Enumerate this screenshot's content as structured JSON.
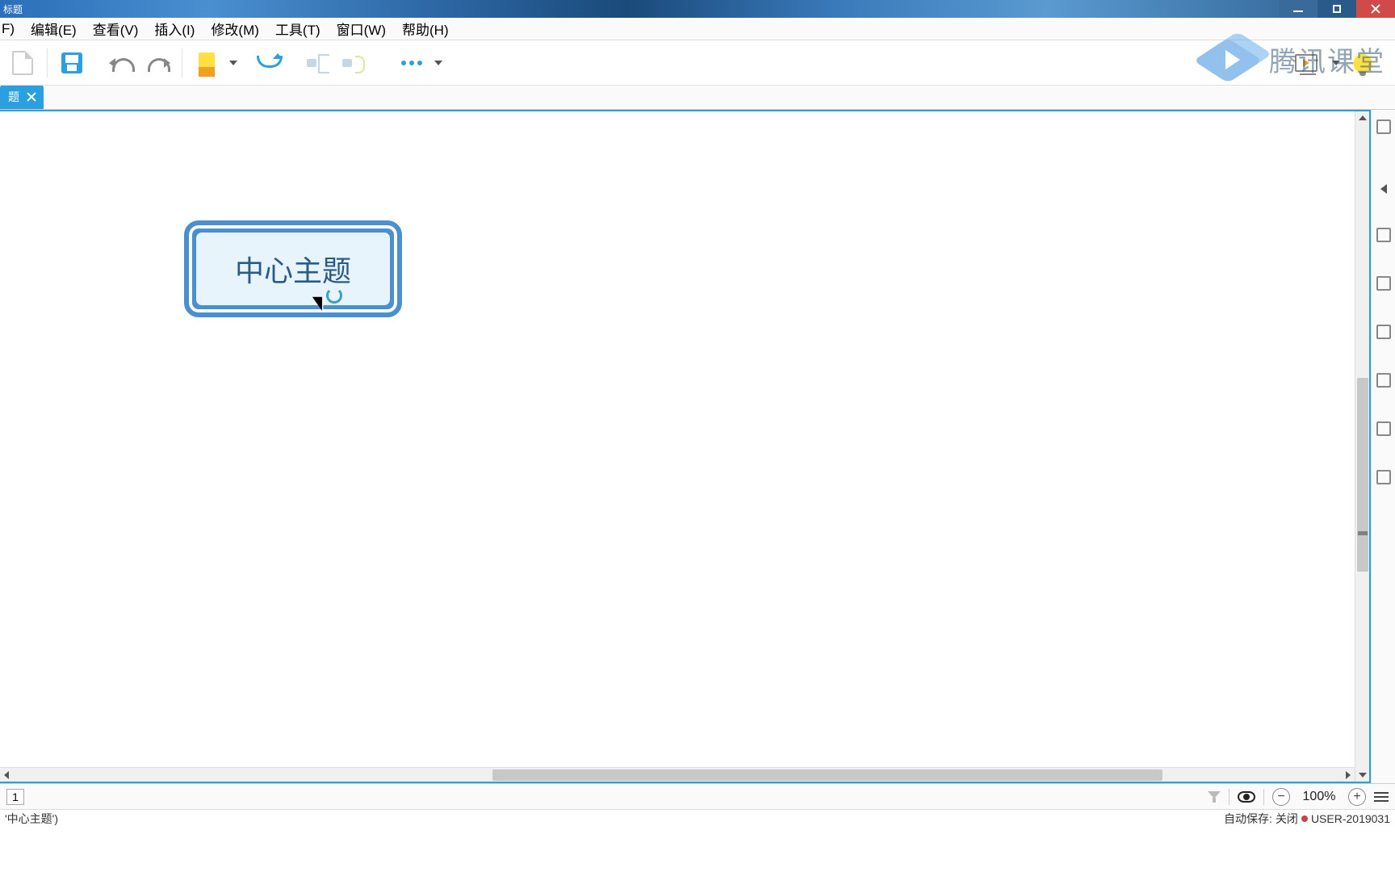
{
  "window": {
    "title_fragment": "标题"
  },
  "menu": {
    "file": "F)",
    "edit": "编辑(E)",
    "view": "查看(V)",
    "insert": "插入(I)",
    "modify": "修改(M)",
    "tools": "工具(T)",
    "window": "窗口(W)",
    "help": "帮助(H)"
  },
  "watermark": {
    "text": "腾讯课堂"
  },
  "tab": {
    "label_fragment": "题"
  },
  "canvas": {
    "central_topic": "中心主题"
  },
  "bottom": {
    "page": "1",
    "zoom": "100%"
  },
  "status": {
    "selection_fragment": "'中心主题')",
    "autosave_label": "自动保存:",
    "autosave_state": "关闭",
    "user_fragment": "USER-2019031"
  }
}
